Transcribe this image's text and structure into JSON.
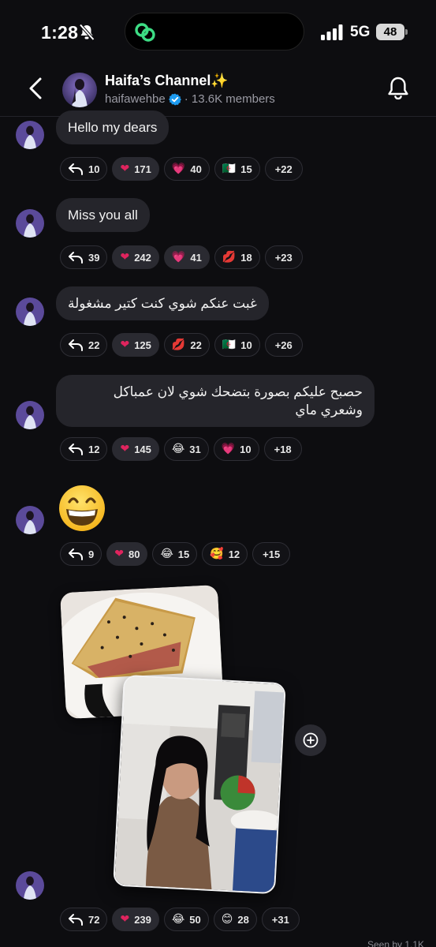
{
  "status_bar": {
    "time": "1:28",
    "network": "5G",
    "battery": "48"
  },
  "header": {
    "title": "Haifa’s Channel✨",
    "handle": "haifawehbe",
    "members": "· 13.6K members"
  },
  "messages": [
    {
      "text": "Hello my dears",
      "reactions": {
        "reply": "10",
        "r1": "171",
        "r2": "40",
        "r3": "15",
        "more": "+22"
      }
    },
    {
      "text": "Miss you all",
      "reactions": {
        "reply": "39",
        "r1": "242",
        "r2": "41",
        "r3": "18",
        "more": "+23"
      }
    },
    {
      "text": "غبت عنكم شوي كنت كتير مشغولة",
      "reactions": {
        "reply": "22",
        "r1": "125",
        "r2": "22",
        "r3": "10",
        "more": "+26"
      }
    },
    {
      "text": "حصبح عليكم بصورة بتضحك شوي لان عمباكل وشعري ماي",
      "reactions": {
        "reply": "12",
        "r1": "145",
        "r2": "31",
        "r3": "10",
        "more": "+18"
      }
    },
    {
      "text": "",
      "reactions": {
        "reply": "9",
        "r1": "80",
        "r2": "15",
        "r3": "12",
        "more": "+15"
      }
    },
    {
      "text": "",
      "reactions": {
        "reply": "72",
        "r1": "239",
        "r2": "50",
        "r3": "28",
        "more": "+31"
      }
    }
  ],
  "emojis": {
    "heart": "❤",
    "pink_heart": "💗",
    "algeria_flag": "🇩🇿",
    "kiss": "💋",
    "joy": "😂",
    "smiling_hearts": "🥰",
    "blush": "😊"
  },
  "footer": {
    "seen": "Seen by 1.1K"
  },
  "icons": [
    "bell-slash-icon",
    "island-link-icon",
    "signal-icon",
    "back-chevron-icon",
    "verified-badge-icon",
    "bell-icon",
    "reply-arrow-icon",
    "add-reaction-icon",
    "grinning-face-icon"
  ],
  "colors": {
    "background": "#0d0d10",
    "bubble": "#25252b",
    "heart": "#e0245e",
    "verified": "#1d9bf0"
  }
}
